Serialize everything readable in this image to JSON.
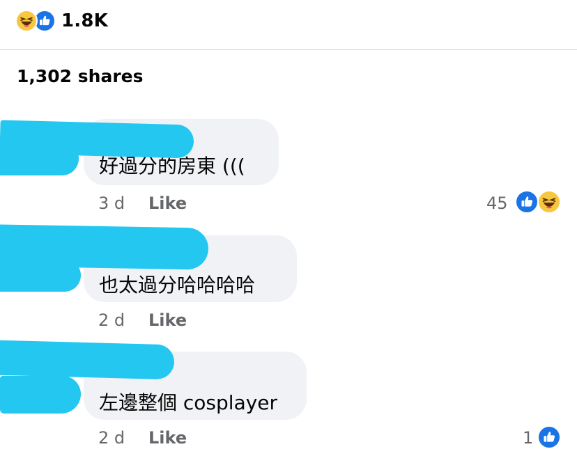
{
  "post": {
    "reaction_total": "1.8K",
    "reaction_icons": [
      "haha-icon",
      "like-icon"
    ],
    "shares": "1,302 shares"
  },
  "colors": {
    "like_blue": "#1b74e4",
    "haha_yellow": "#f7c73f",
    "bubble_bg": "#f0f2f5",
    "redaction_cyan": "#23c7ef",
    "meta_gray": "#65676b"
  },
  "comments": [
    {
      "text": "好過分的房東 (((",
      "time": "3 d",
      "like_label": "Like",
      "reaction_count": "45",
      "reaction_icons": [
        "like-icon",
        "haha-icon"
      ]
    },
    {
      "text": "也太過分哈哈哈哈",
      "time": "2 d",
      "like_label": "Like"
    },
    {
      "text": "左邊整個 cosplayer",
      "time": "2 d",
      "like_label": "Like",
      "reaction_count": "1",
      "reaction_icons": [
        "like-icon"
      ]
    }
  ]
}
